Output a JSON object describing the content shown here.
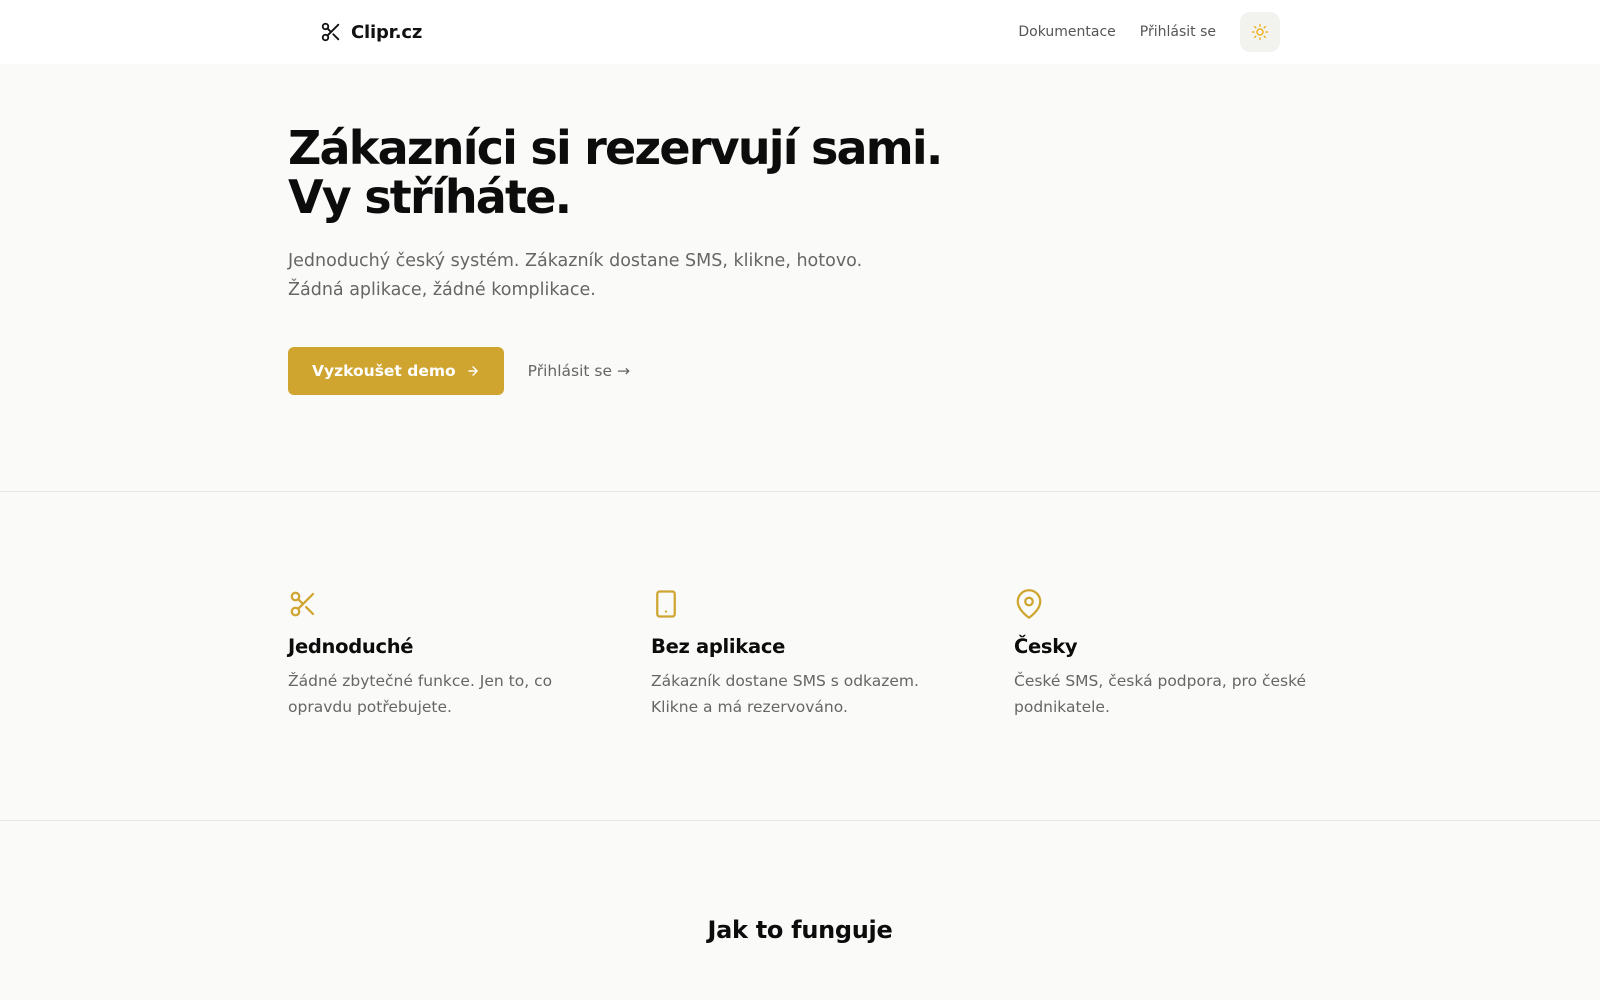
{
  "nav": {
    "logo_text": "Clipr.cz",
    "links": [
      "Dokumentace",
      "Přihlásit se"
    ],
    "theme_icon": "sun-icon"
  },
  "hero": {
    "title_lines": [
      "Zákazníci si rezervují sami.",
      "Vy stříháte."
    ],
    "subtitle_lines": [
      "Jednoduchý český systém. Zákazník dostane SMS, klikne, hotovo.",
      "Žádná aplikace, žádné komplikace."
    ],
    "cta_label": "Vyzkoušet demo",
    "secondary_label": "Přihlásit se →"
  },
  "features": [
    {
      "icon": "scissors-icon",
      "title": "Jednoduché",
      "text_lines": [
        "Žádné zbytečné funkce. Jen to, co",
        "opravdu potřebujete."
      ]
    },
    {
      "icon": "smartphone-icon",
      "title": "Bez aplikace",
      "text_lines": [
        "Zákazník dostane SMS s odkazem.",
        "Klikne a má rezervováno."
      ]
    },
    {
      "icon": "map-pin-icon",
      "title": "Česky",
      "text_lines": [
        "České SMS, česká podpora, pro české",
        "podnikatele."
      ]
    }
  ],
  "how_it_works": {
    "title": "Jak to funguje"
  },
  "colors": {
    "accent": "#cfa530",
    "background": "#fafaf8",
    "text": "#0f0f0f",
    "muted": "#666666",
    "sun": "#f0b323"
  }
}
